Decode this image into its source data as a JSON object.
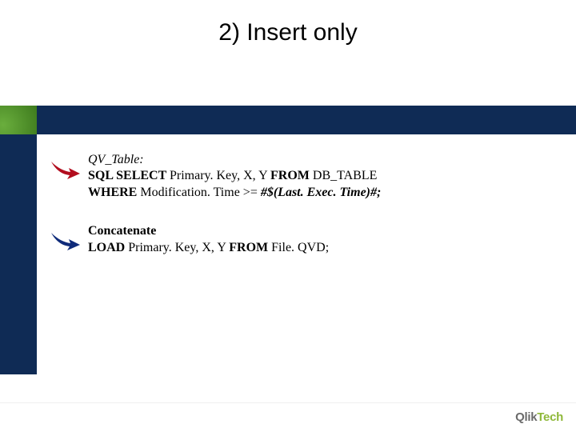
{
  "title": "2) Insert only",
  "block1": {
    "line1_italic": "QV_Table:",
    "line2_kw1": "SQL SELECT ",
    "line2_txt1": "Primary. Key, X, Y ",
    "line2_kw2": "FROM ",
    "line2_txt2": "DB_TABLE",
    "line3_kw1": "WHERE ",
    "line3_txt1": "Modification. Time >= ",
    "line3_var": "#$(Last. Exec. Time)#;",
    "arrow_color": "#b20d1e"
  },
  "block2": {
    "line1_kw": "Concatenate",
    "line2_kw1": "LOAD ",
    "line2_txt1": "Primary. Key, X, Y ",
    "line2_kw2": "FROM ",
    "line2_txt2": "File. QVD;",
    "arrow_color": "#0f2b7a"
  },
  "logo": {
    "brand1": "Qlik",
    "brand2": "Tech"
  }
}
